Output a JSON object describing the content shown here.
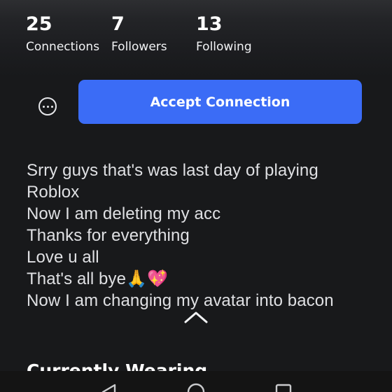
{
  "stats": {
    "connections": {
      "count": "25",
      "label": "Connections"
    },
    "followers": {
      "count": "7",
      "label": "Followers"
    },
    "following": {
      "count": "13",
      "label": "Following"
    }
  },
  "actions": {
    "more_icon": "more-horizontal-circle-icon",
    "accept_label": "Accept Connection",
    "accent_color": "#3b6cf6"
  },
  "about": {
    "lines": [
      "Srry guys that's was last day of playing",
      "Roblox",
      "Now I am deleting my acc",
      "Thanks for everything",
      "Love u all",
      "That's all bye🙏💖",
      "Now I am changing my avatar into bacon"
    ],
    "collapse_icon": "chevron-up-icon"
  },
  "section": {
    "title": "Currently Wearing"
  },
  "navigation_bar": {
    "icons": [
      "back-triangle-icon",
      "home-circle-icon",
      "recents-square-icon"
    ]
  }
}
